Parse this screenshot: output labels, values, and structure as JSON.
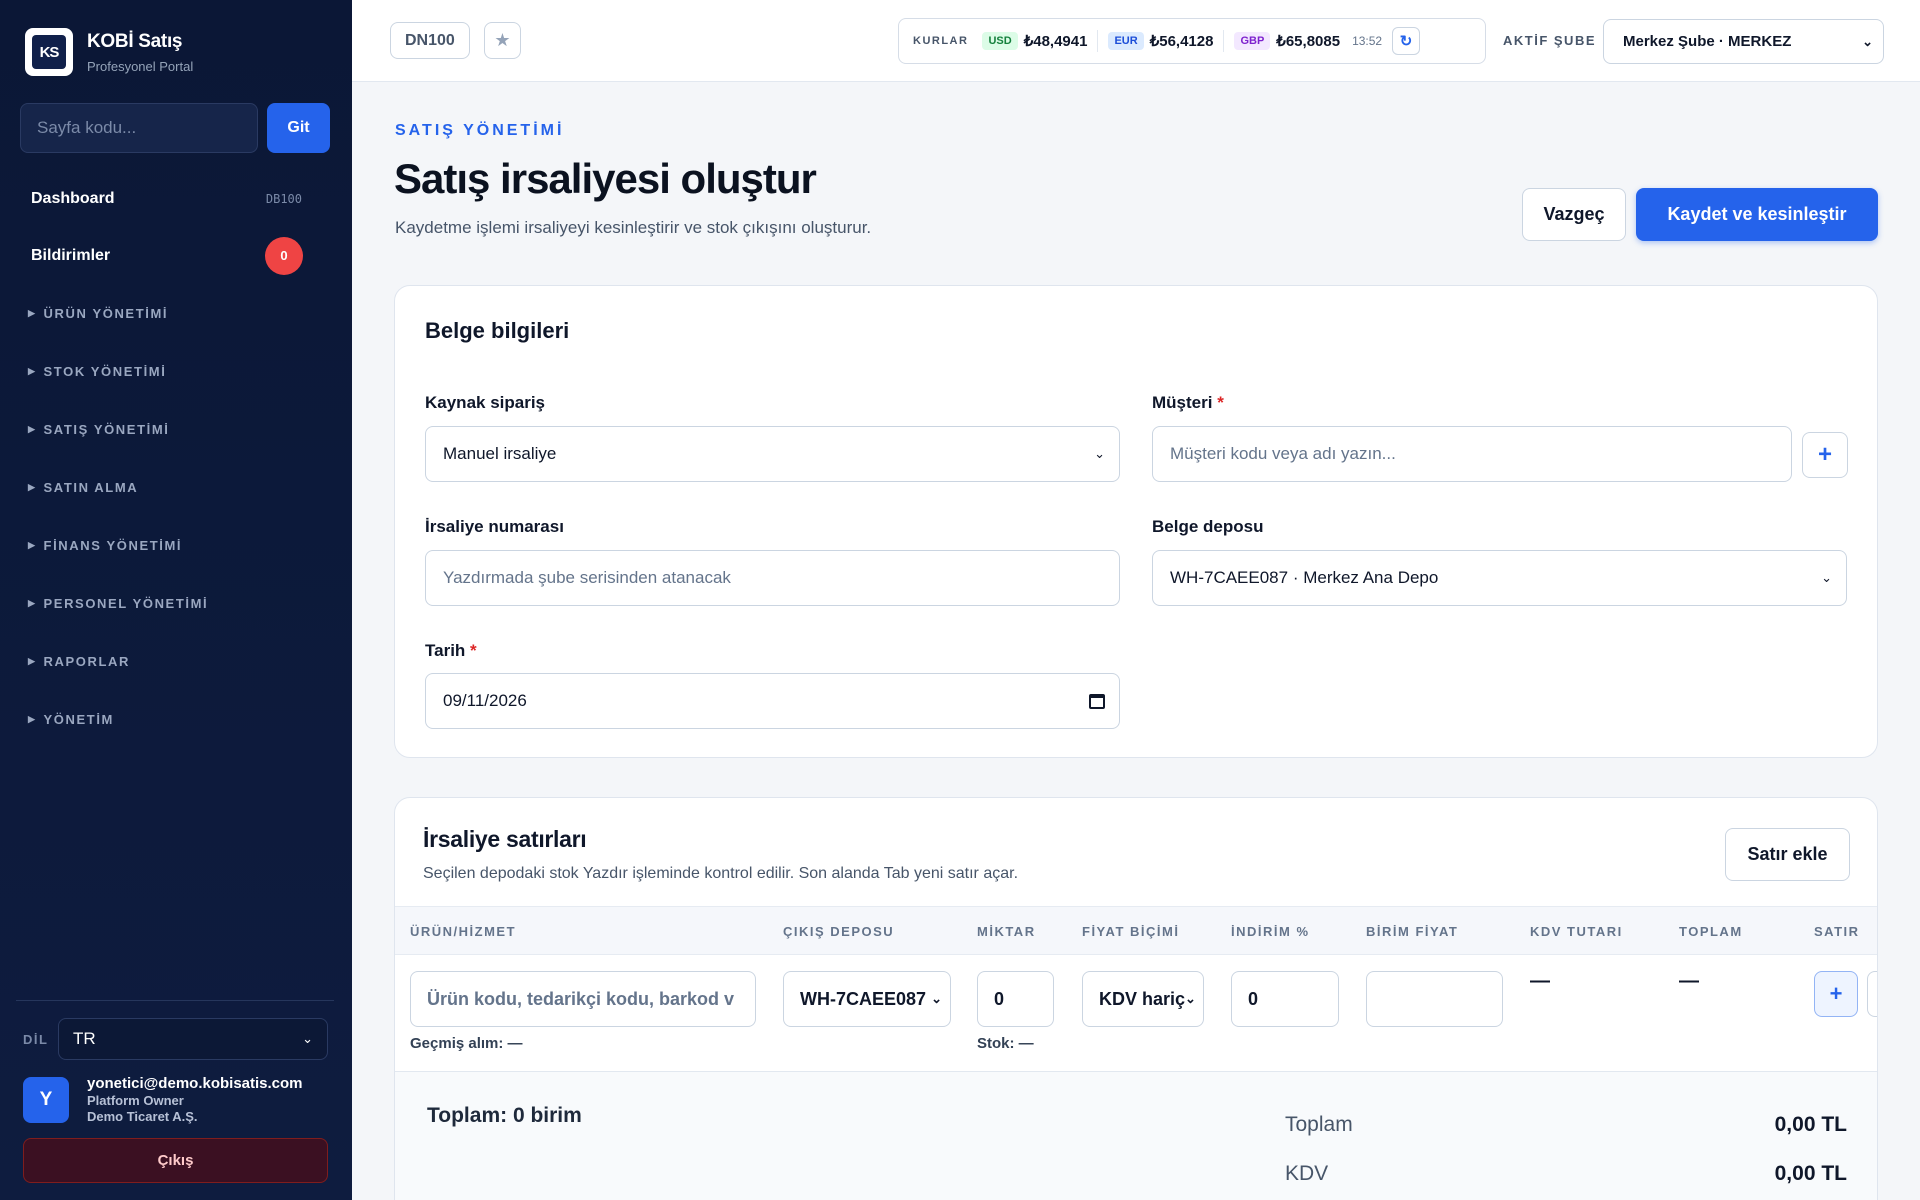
{
  "sidebar": {
    "logo_text": "KS",
    "brand_title": "KOBİ Satış",
    "brand_sub": "Profesyonel Portal",
    "goto_placeholder": "Sayfa kodu...",
    "goto_button": "Git",
    "dashboard_label": "Dashboard",
    "dashboard_code": "DB100",
    "notifications_label": "Bildirimler",
    "notifications_count": "0",
    "sections": [
      "ÜRÜN YÖNETİMİ",
      "STOK YÖNETİMİ",
      "SATIŞ YÖNETİMİ",
      "SATIN ALMA",
      "FİNANS YÖNETİMİ",
      "PERSONEL YÖNETİMİ",
      "RAPORLAR",
      "YÖNETİM"
    ],
    "lang_label": "DİL",
    "lang_value": "TR",
    "user_initial": "Y",
    "user_email": "yonetici@demo.kobisatis.com",
    "user_role": "Platform Owner",
    "user_company": "Demo Ticaret A.Ş.",
    "logout_label": "Çıkış"
  },
  "topbar": {
    "page_code": "DN100",
    "rates_label": "KURLAR",
    "rates": [
      {
        "code": "USD",
        "value": "₺48,4941",
        "bg": "#dcfce7",
        "fg": "#15803d"
      },
      {
        "code": "EUR",
        "value": "₺56,4128",
        "bg": "#dbeafe",
        "fg": "#1d4ed8"
      },
      {
        "code": "GBP",
        "value": "₺65,8085",
        "bg": "#f3e8ff",
        "fg": "#7e22ce"
      }
    ],
    "rates_time": "13:52",
    "branch_label": "AKTİF ŞUBE",
    "branch_value": "Merkez Şube · MERKEZ"
  },
  "page": {
    "overline": "SATIŞ YÖNETİMİ",
    "title": "Satış irsaliyesi oluştur",
    "subtitle": "Kaydetme işlemi irsaliyeyi kesinleştirir ve stok çıkışını oluşturur.",
    "cancel_label": "Vazgeç",
    "save_label": "Kaydet ve kesinleştir"
  },
  "doc": {
    "title": "Belge bilgileri",
    "source_label": "Kaynak sipariş",
    "source_value": "Manuel irsaliye",
    "customer_label": "Müşteri",
    "customer_placeholder": "Müşteri kodu veya adı yazın...",
    "number_label": "İrsaliye numarası",
    "number_placeholder": "Yazdırmada şube serisinden atanacak",
    "warehouse_label": "Belge deposu",
    "warehouse_value": "WH-7CAEE087 · Merkez Ana Depo",
    "date_label": "Tarih",
    "date_value": "09/11/2026",
    "required_mark": "*"
  },
  "lines": {
    "title": "İrsaliye satırları",
    "subtitle": "Seçilen depodaki stok Yazdır işleminde kontrol edilir. Son alanda Tab yeni satır açar.",
    "add_row_label": "Satır ekle",
    "columns": {
      "product": "ÜRÜN/HİZMET",
      "warehouse": "ÇIKIŞ DEPOSU",
      "qty": "MİKTAR",
      "price_type": "FİYAT BİÇİMİ",
      "discount": "İNDİRİM %",
      "unit_price": "BİRİM FİYAT",
      "vat": "KDV TUTARI",
      "total": "TOPLAM",
      "row": "SATIR"
    },
    "row": {
      "product_placeholder": "Ürün kodu, tedarikçi kodu, barkod v",
      "warehouse": "WH-7CAEE087",
      "qty": "0",
      "price_type": "KDV hariç",
      "discount": "0",
      "vat": "—",
      "total": "—",
      "past_purchase": "Geçmiş alım: —",
      "stock": "Stok: —"
    },
    "summary": {
      "units": "Toplam: 0 birim",
      "total_label": "Toplam",
      "total_value": "0,00 TL",
      "vat_label": "KDV",
      "vat_value": "0,00 TL"
    }
  }
}
